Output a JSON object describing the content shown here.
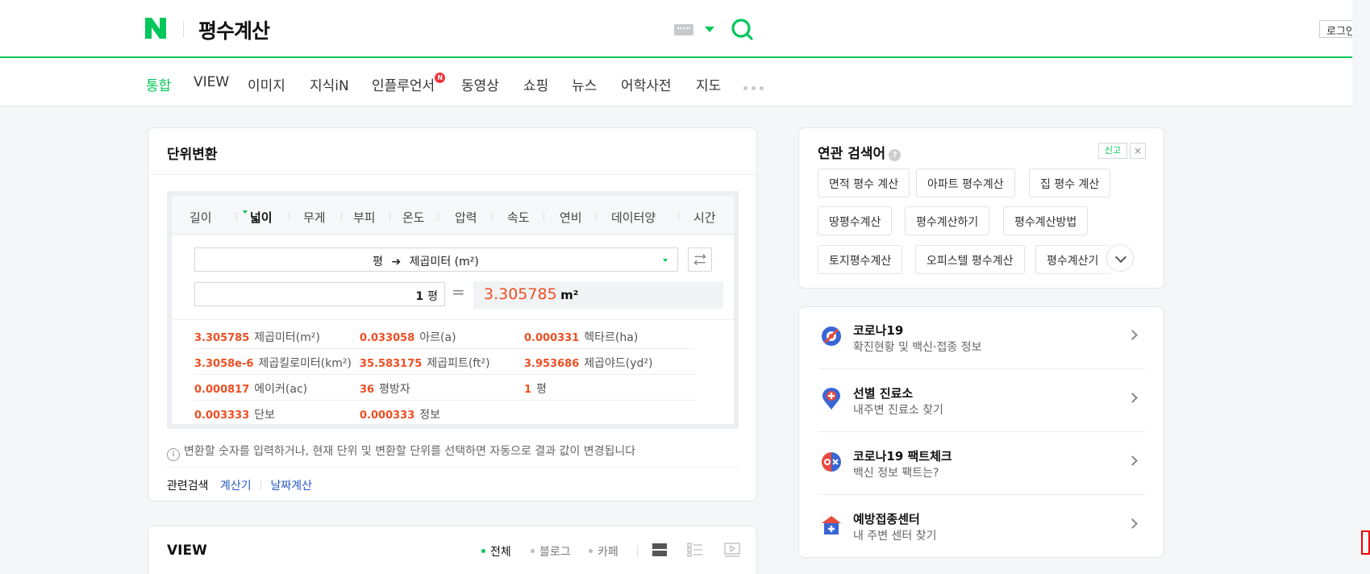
{
  "header": {
    "query": "평수계산",
    "login": "로그인",
    "brand_color": "#03c75a"
  },
  "nav": {
    "tabs": [
      "통합",
      "VIEW",
      "이미지",
      "지식iN",
      "인플루언서",
      "동영상",
      "쇼핑",
      "뉴스",
      "어학사전",
      "지도"
    ],
    "active": "통합",
    "badge": "N"
  },
  "converter": {
    "title": "단위변환",
    "unit_tabs": [
      "길이",
      "넓이",
      "무게",
      "부피",
      "온도",
      "압력",
      "속도",
      "연비",
      "데이터양",
      "시간"
    ],
    "active_tab": "넓이",
    "from_unit": "평",
    "to_unit": "제곱미터 (m²)",
    "input_value": "1",
    "input_unit": "평",
    "result_value": "3.305785",
    "result_unit": "m²",
    "results": [
      {
        "value": "3.305785",
        "unit": "제곱미터(m²)"
      },
      {
        "value": "0.033058",
        "unit": "아르(a)"
      },
      {
        "value": "0.000331",
        "unit": "헥타르(ha)"
      },
      {
        "value": "3.3058e-6",
        "unit": "제곱킬로미터(km²)"
      },
      {
        "value": "35.583175",
        "unit": "제곱피트(ft²)"
      },
      {
        "value": "3.953686",
        "unit": "제곱야드(yd²)"
      },
      {
        "value": "0.000817",
        "unit": "에이커(ac)"
      },
      {
        "value": "36",
        "unit": "평방자"
      },
      {
        "value": "1",
        "unit": "평"
      },
      {
        "value": "0.003333",
        "unit": "단보"
      },
      {
        "value": "0.000333",
        "unit": "정보"
      }
    ],
    "info": "변환할 숫자를 입력하거나, 현재 단위 및 변환할 단위를 선택하면 자동으로 결과 값이 변경됩니다",
    "related_label": "관련검색",
    "related_links": [
      "계산기",
      "날짜계산"
    ],
    "accent_color": "#f04e23"
  },
  "view_section": {
    "title": "VIEW",
    "filters": [
      "전체",
      "블로그",
      "카페"
    ],
    "active_filter": "전체"
  },
  "related_searches": {
    "title": "연관 검색어",
    "report": "신고",
    "close": "×",
    "chips": [
      "면적 평수 계산",
      "아파트 평수계산",
      "집 평수 계산",
      "땅평수계산",
      "평수계산하기",
      "평수계산방법",
      "토지평수계산",
      "오피스텔 평수계산",
      "평수계산기"
    ]
  },
  "covid": {
    "items": [
      {
        "name": "코로나19",
        "desc": "확진현황 및 백신·접종 정보",
        "icon": "covid-virus-icon"
      },
      {
        "name": "선별 진료소",
        "desc": "내주변 진료소 찾기",
        "icon": "clinic-pin-icon"
      },
      {
        "name": "코로나19 팩트체크",
        "desc": "백신 정보 팩트는?",
        "icon": "factcheck-ox-icon"
      },
      {
        "name": "예방접종센터",
        "desc": "내 주변 센터 찾기",
        "icon": "vaccine-center-icon"
      }
    ]
  }
}
